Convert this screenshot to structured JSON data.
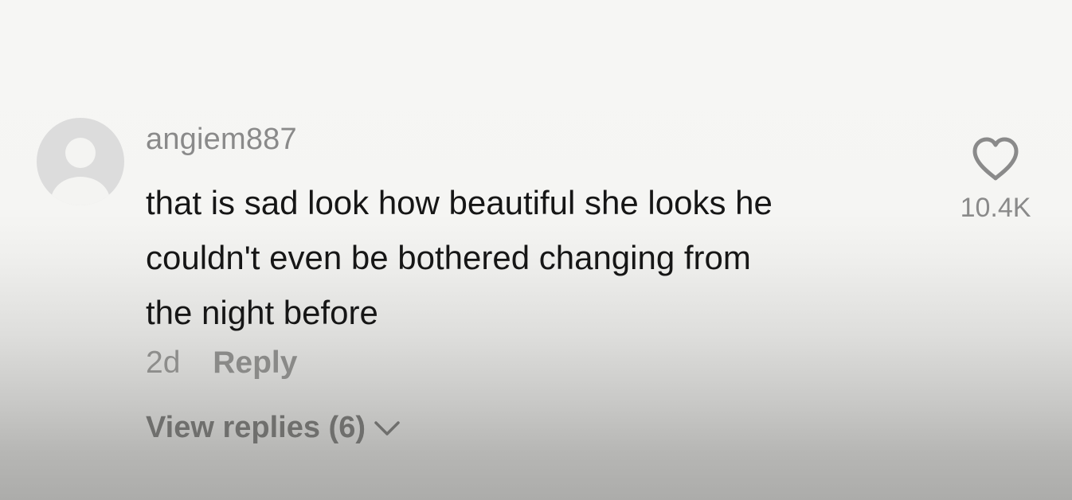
{
  "comment": {
    "avatar_icon": "default-avatar-icon",
    "username": "angiem887",
    "text_lines": [
      "that is sad look how beautiful she looks he",
      "couldn't even be bothered changing from",
      "the night before"
    ],
    "time": "2d",
    "reply_label": "Reply",
    "view_replies_label": "View replies (6)",
    "chevron_icon": "chevron-down-icon",
    "like_icon": "heart-icon",
    "like_count": "10.4K"
  },
  "colors": {
    "username": "#8a8a8a",
    "text": "#161616",
    "meta": "#8d8d8b"
  }
}
